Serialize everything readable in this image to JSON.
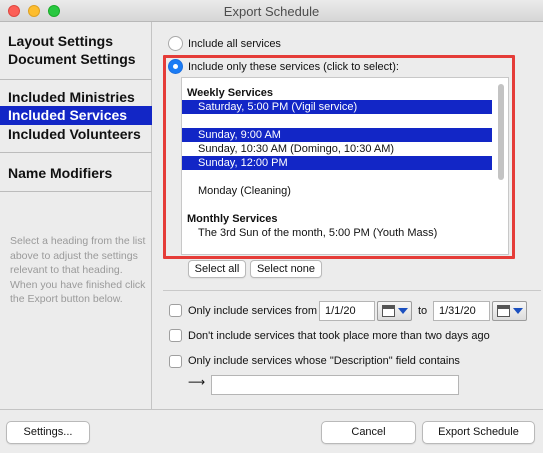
{
  "window": {
    "title": "Export Schedule"
  },
  "sidebar": {
    "items": [
      {
        "label": "Layout Settings"
      },
      {
        "label": "Document Settings"
      },
      {
        "label": "Included Ministries"
      },
      {
        "label": "Included Services"
      },
      {
        "label": "Included Volunteers"
      },
      {
        "label": "Name Modifiers"
      }
    ],
    "selected": "Included Services",
    "help_text": "Select a heading from the list above to adjust the settings relevant to that heading. When you have finished click the Export button below."
  },
  "main": {
    "radio_all": "Include all services",
    "radio_only": "Include only these services (click to select):",
    "list": {
      "rows": [
        {
          "text": "Weekly Services",
          "type": "heading",
          "selected": false
        },
        {
          "text": "Saturday, 5:00 PM (Vigil service)",
          "type": "item",
          "selected": true
        },
        {
          "text": "",
          "type": "blank",
          "selected": false
        },
        {
          "text": "Sunday, 9:00 AM",
          "type": "item",
          "selected": true
        },
        {
          "text": "Sunday, 10:30 AM (Domingo, 10:30 AM)",
          "type": "item",
          "selected": false
        },
        {
          "text": "Sunday, 12:00 PM",
          "type": "item",
          "selected": true
        },
        {
          "text": "",
          "type": "blank",
          "selected": false
        },
        {
          "text": "Monday (Cleaning)",
          "type": "item",
          "selected": false
        },
        {
          "text": "",
          "type": "blank",
          "selected": false
        },
        {
          "text": "Monthly Services",
          "type": "heading",
          "selected": false
        },
        {
          "text": "The 3rd Sun of the month, 5:00 PM (Youth Mass)",
          "type": "item",
          "selected": false
        }
      ]
    },
    "select_all": "Select all",
    "select_none": "Select none",
    "date_filter": {
      "label": "Only include services from",
      "from": "1/1/20",
      "to_label": "to",
      "to": "1/31/20"
    },
    "recent_filter": "Don't include services that took place more than two days ago",
    "desc_filter": "Only include services whose \"Description\" field contains",
    "desc_value": ""
  },
  "footer": {
    "settings": "Settings...",
    "cancel": "Cancel",
    "export": "Export Schedule"
  },
  "colors": {
    "selection": "#1226c6",
    "highlight_border": "#e53c38",
    "radio_on": "#1a7cf5"
  }
}
